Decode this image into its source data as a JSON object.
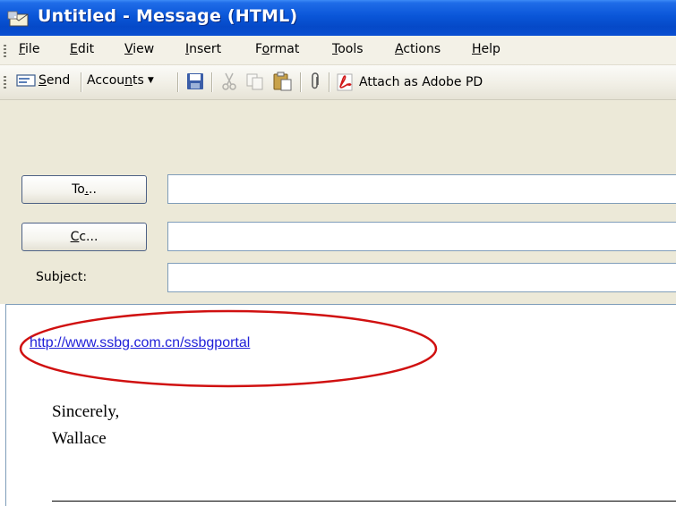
{
  "window": {
    "title": "Untitled - Message (HTML)"
  },
  "menubar": {
    "items": [
      {
        "label": "File",
        "accel": "F",
        "rest": "ile"
      },
      {
        "label": "Edit",
        "accel": "E",
        "rest": "dit"
      },
      {
        "label": "View",
        "accel": "V",
        "rest": "iew"
      },
      {
        "label": "Insert",
        "accel": "I",
        "rest": "nsert"
      },
      {
        "label": "Format",
        "accel_pre": "F",
        "accel": "o",
        "rest": "rmat"
      },
      {
        "label": "Tools",
        "accel": "T",
        "rest": "ools"
      },
      {
        "label": "Actions",
        "accel": "A",
        "rest": "ctions"
      },
      {
        "label": "Help",
        "accel": "H",
        "rest": "elp"
      }
    ]
  },
  "toolbar": {
    "send_label_accel": "S",
    "send_label_rest": "end",
    "accounts_pre": "Accou",
    "accounts_accel": "n",
    "accounts_rest": "ts",
    "attach_pdf_label": "Attach as Adobe PD"
  },
  "header": {
    "to_button_pre": "To",
    "to_button_accel": ".",
    "to_button_rest": "..",
    "cc_button_accel": "C",
    "cc_button_rest": "c...",
    "subject_label": "Subject:",
    "to_value": "",
    "cc_value": "",
    "subject_value": ""
  },
  "body": {
    "link": "http://www.ssbg.com.cn/ssbgportal",
    "closing": "Sincerely,",
    "signature": "Wallace"
  },
  "colors": {
    "titlebar": "#0a56d8",
    "link": "#1f1fd8",
    "annotation_oval": "#d01010"
  }
}
